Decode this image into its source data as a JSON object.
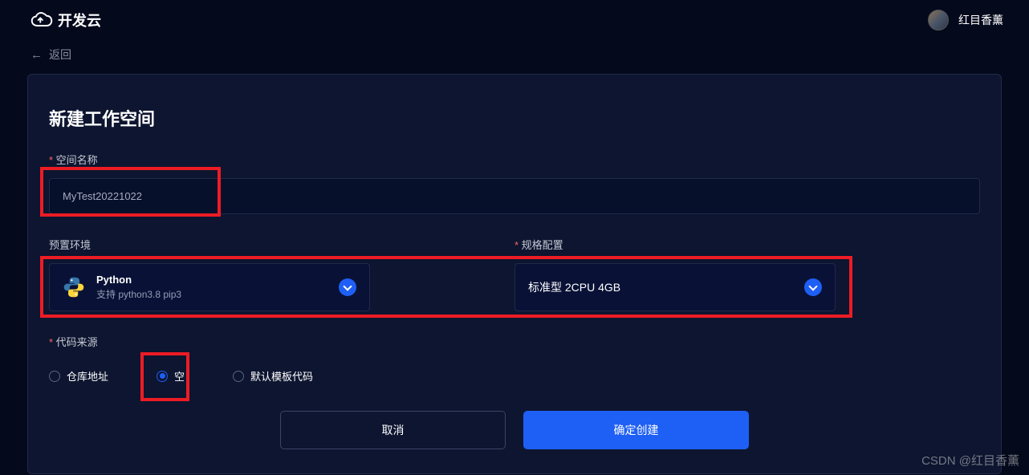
{
  "header": {
    "logo_text": "开发云",
    "username": "红目香薰"
  },
  "nav": {
    "back_label": "返回"
  },
  "form": {
    "title": "新建工作空间",
    "name_label": "空间名称",
    "name_value": "MyTest20221022",
    "env_label": "预置环境",
    "spec_label": "规格配置",
    "env_select": {
      "title": "Python",
      "subtitle": "支持 python3.8 pip3"
    },
    "spec_select": {
      "value": "标准型 2CPU 4GB"
    },
    "source_label": "代码来源",
    "source_options": [
      {
        "label": "仓库地址",
        "selected": false
      },
      {
        "label": "空",
        "selected": true
      },
      {
        "label": "默认模板代码",
        "selected": false
      }
    ],
    "cancel_label": "取消",
    "confirm_label": "确定创建"
  },
  "watermark": "CSDN @红目香薰"
}
